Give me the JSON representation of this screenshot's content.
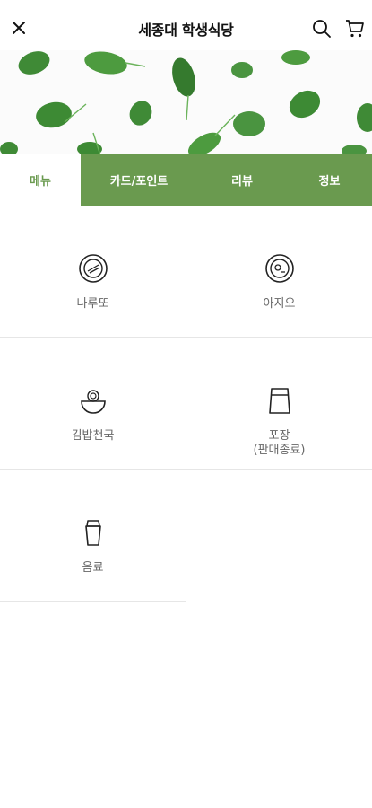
{
  "header": {
    "title": "세종대 학생식당",
    "close_icon": "close-icon",
    "search_icon": "search-icon",
    "cart_icon": "cart-icon"
  },
  "banner": {
    "image": "spinach-leaves-photo"
  },
  "tabs": [
    {
      "label": "메뉴",
      "active": true
    },
    {
      "label": "카드/포인트",
      "active": false
    },
    {
      "label": "리뷰",
      "active": false
    },
    {
      "label": "정보",
      "active": false
    }
  ],
  "categories": [
    {
      "label": "나루또",
      "icon": "plate-food-icon"
    },
    {
      "label": "아지오",
      "icon": "plate-egg-icon"
    },
    {
      "label": "김밥천국",
      "icon": "noodle-bowl-icon"
    },
    {
      "label": "포장\n(판매종료)",
      "icon": "takeout-bag-icon"
    },
    {
      "label": "음료",
      "icon": "drink-cup-icon"
    }
  ],
  "colors": {
    "accent": "#6a9a4f",
    "tab_text": "#ffffff",
    "label_text": "#666666",
    "divider": "#e6e6e6"
  }
}
